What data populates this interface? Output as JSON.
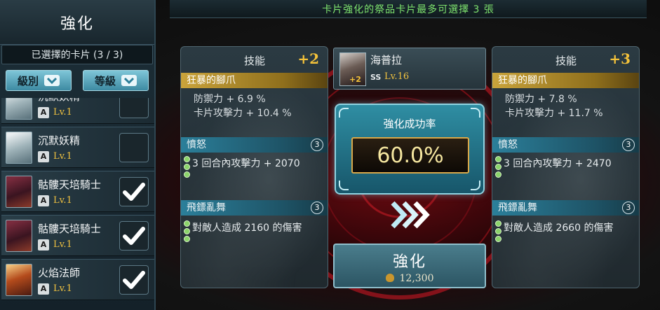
{
  "banner": {
    "text": "卡片強化的祭品卡片最多可選擇 3 張"
  },
  "left_panel": {
    "title": "強化",
    "selected_label": "已選擇的卡片 (3 / 3)",
    "filters": [
      {
        "label": "級別"
      },
      {
        "label": "等級"
      }
    ],
    "cards": [
      {
        "name": "沉默妖精",
        "rank": "A",
        "level": "Lv.1",
        "selected": false,
        "thumb": "fairy"
      },
      {
        "name": "沉默妖精",
        "rank": "A",
        "level": "Lv.1",
        "selected": false,
        "thumb": "fairy"
      },
      {
        "name": "骷髏天培騎士",
        "rank": "A",
        "level": "Lv.1",
        "selected": true,
        "thumb": "knight"
      },
      {
        "name": "骷髏天培騎士",
        "rank": "A",
        "level": "Lv.1",
        "selected": true,
        "thumb": "knight"
      },
      {
        "name": "火焰法師",
        "rank": "A",
        "level": "Lv.1",
        "selected": true,
        "thumb": "mage"
      }
    ]
  },
  "current_skill": {
    "title": "技能",
    "level": "+2",
    "passive_name": "狂暴的腳爪",
    "stats": [
      "防禦力 + 6.9 %",
      "卡片攻擊力 + 10.4 %"
    ],
    "skills": [
      {
        "name": "憤怒",
        "count": "3",
        "desc": "3 回合內攻擊力 + 2070"
      },
      {
        "name": "飛鏢亂舞",
        "count": "3",
        "desc": "對敵人造成 2160 的傷害"
      }
    ]
  },
  "next_skill": {
    "title": "技能",
    "level": "+3",
    "passive_name": "狂暴的腳爪",
    "stats": [
      "防禦力 + 7.8 %",
      "卡片攻擊力 + 11.7 %"
    ],
    "skills": [
      {
        "name": "憤怒",
        "count": "3",
        "desc": "3 回合內攻擊力 + 2470"
      },
      {
        "name": "飛鏢亂舞",
        "count": "3",
        "desc": "對敵人造成 2660 的傷害"
      }
    ]
  },
  "target_card": {
    "name": "海普拉",
    "plus": "+2",
    "rarity": "SS",
    "level": "Lv.16"
  },
  "success_rate": {
    "title": "強化成功率",
    "value": "60.0%"
  },
  "enhance_button": {
    "label": "強化",
    "cost": "12,300"
  },
  "icons": {
    "chevron": "chevron-down-icon",
    "check": "check-icon",
    "arrows": "triple-chevron-right-icon",
    "coin": "coin-bag-icon"
  },
  "colors": {
    "accent_gold": "#f4c23a",
    "banner_text": "#7ee36e",
    "section_blue": "#2b7f9a",
    "rate_text": "#f6e7a0"
  }
}
